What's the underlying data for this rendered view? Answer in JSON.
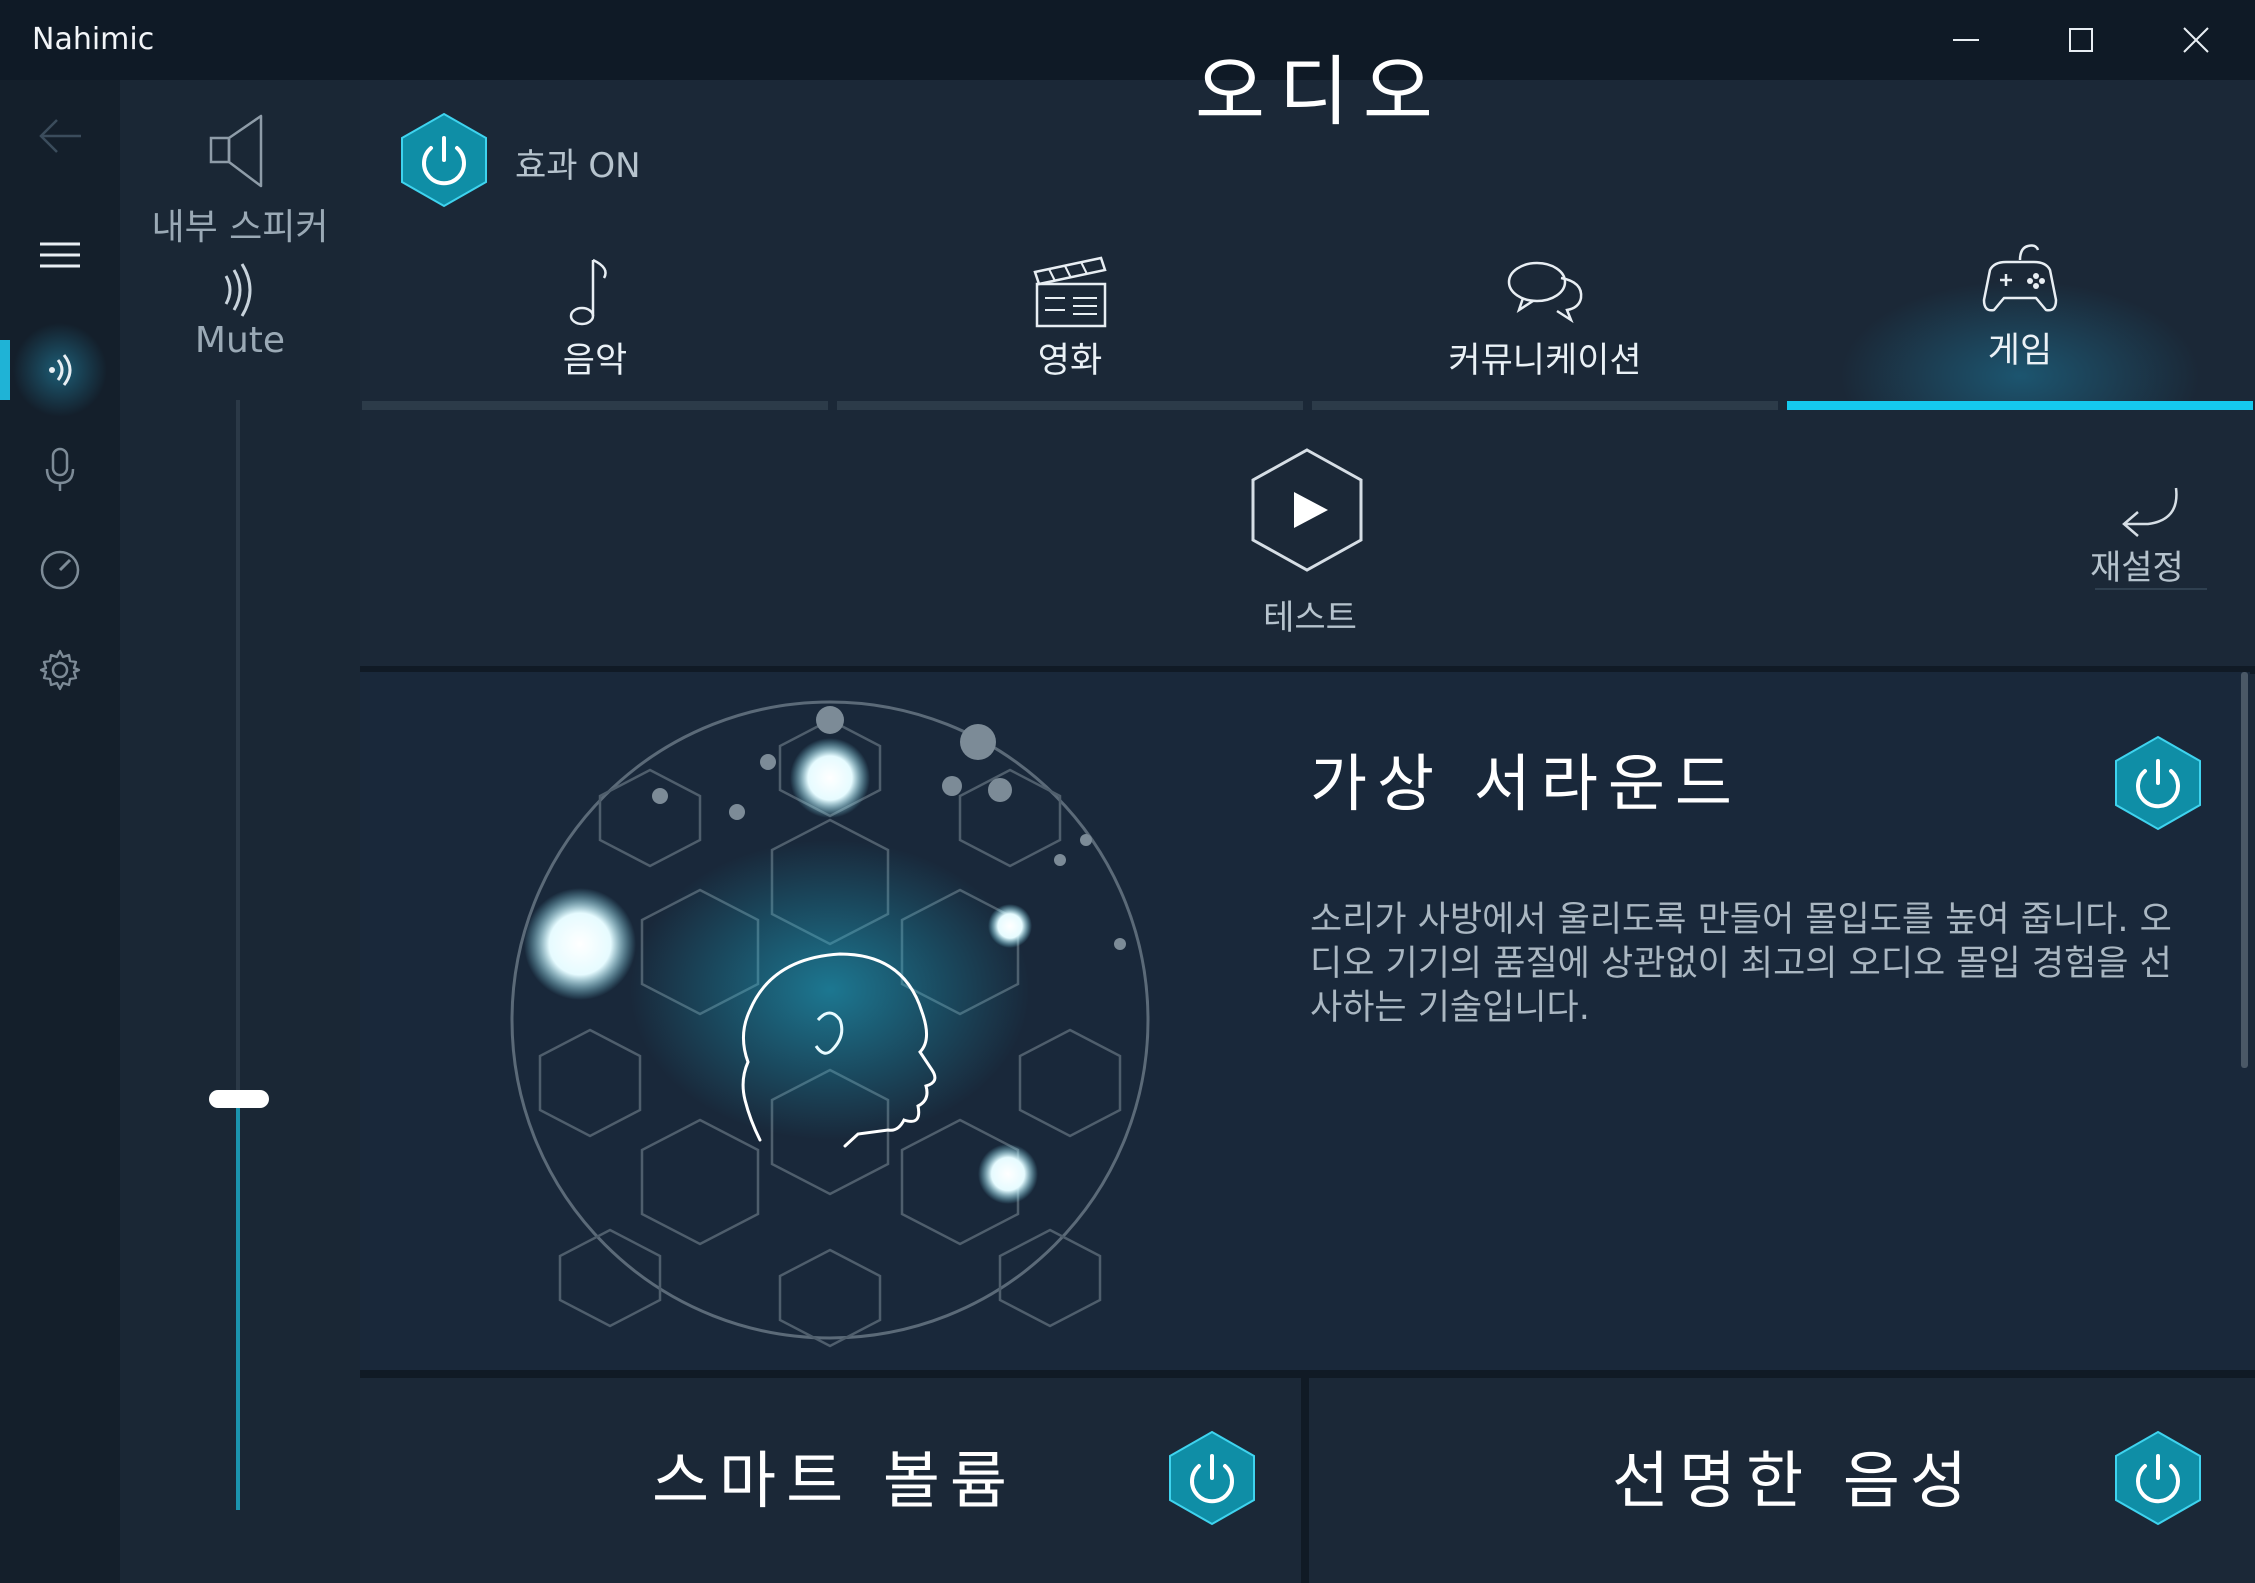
{
  "window": {
    "title": "Nahimic",
    "controls": [
      "minimize",
      "maximize",
      "close"
    ]
  },
  "nav": {
    "back_icon": "back-arrow-icon",
    "menu_icon": "hamburger-icon",
    "items": [
      {
        "icon": "speaker-waves-icon",
        "active": true
      },
      {
        "icon": "microphone-icon",
        "active": false
      },
      {
        "icon": "gauge-icon",
        "active": false
      },
      {
        "icon": "gear-icon",
        "active": false
      }
    ]
  },
  "device": {
    "name": "내부 스피커",
    "mute_label": "Mute",
    "volume_fraction": 0.37
  },
  "header": {
    "title": "오디오",
    "effect_label": "효과 ON"
  },
  "tabs": [
    {
      "label": "음악",
      "icon": "music-note-icon",
      "active": false
    },
    {
      "label": "영화",
      "icon": "clapperboard-icon",
      "active": false
    },
    {
      "label": "커뮤니케이션",
      "icon": "chat-bubbles-icon",
      "active": false
    },
    {
      "label": "게임",
      "icon": "gamepad-icon",
      "active": true
    }
  ],
  "actions": {
    "test_label": "테스트",
    "reset_label": "재설정"
  },
  "features": {
    "virtual_surround": {
      "title": "가상 서라운드",
      "description": "소리가 사방에서 울리도록 만들어 몰입도를 높여 줍니다. 오디오 기기의 품질에 상관없이 최고의 오디오 몰입 경험을 선사하는 기술입니다.",
      "enabled": true
    },
    "smart_volume": {
      "title": "스마트 볼륨",
      "enabled": true
    },
    "voice_clarity": {
      "title": "선명한 음성",
      "enabled": true
    }
  },
  "colors": {
    "accent": "#15c9ee",
    "hex_button": "#0f8ea6",
    "background": "#1b2837"
  }
}
